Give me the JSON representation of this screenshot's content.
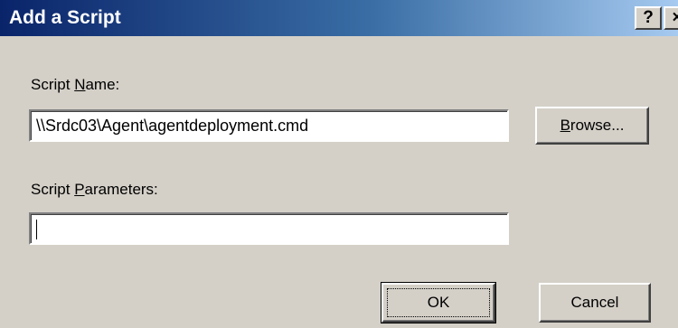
{
  "window": {
    "title": "Add a Script",
    "help_glyph": "?",
    "close_glyph": "×"
  },
  "form": {
    "script_name_label_prefix": "Script ",
    "script_name_label_accel": "N",
    "script_name_label_suffix": "ame:",
    "script_name_value": "\\\\Srdc03\\Agent\\agentdeployment.cmd",
    "script_params_label_prefix": "Script ",
    "script_params_label_accel": "P",
    "script_params_label_suffix": "arameters:",
    "script_params_value": ""
  },
  "buttons": {
    "browse_accel": "B",
    "browse_rest": "rowse...",
    "ok_label": "OK",
    "cancel_label": "Cancel"
  }
}
